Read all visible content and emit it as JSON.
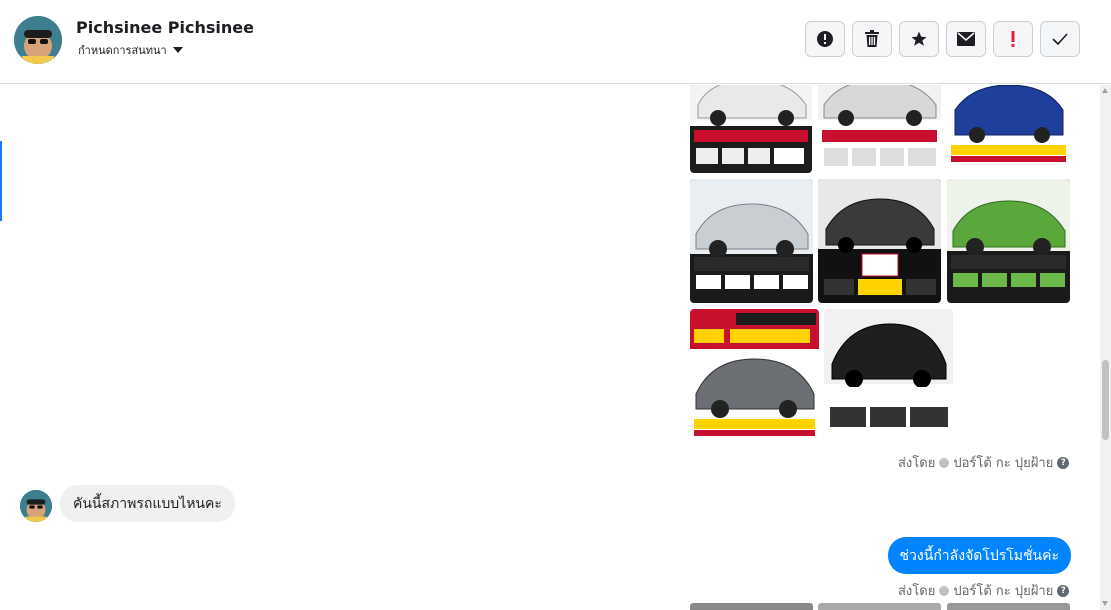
{
  "header": {
    "contact_name": "Pichsinee Pichsinee",
    "subtitle": "กำหนดการสนทนา"
  },
  "toolbar": {
    "buttons": [
      {
        "icon": "alert-circle-icon"
      },
      {
        "icon": "trash-icon"
      },
      {
        "icon": "star-icon"
      },
      {
        "icon": "envelope-icon"
      },
      {
        "icon": "exclamation-icon"
      },
      {
        "icon": "check-icon"
      }
    ]
  },
  "messages": {
    "image_message_meta": {
      "sent_by": "ส่งโดย",
      "sender": "ปอร์โต้ กะ ปุยฝ้าย",
      "help": "?"
    },
    "incoming_text": "คันนี้สภาพรถแบบไหนคะ",
    "outgoing_text": "ช่วงนี้กำลังจัดโปรโมชั่นค่ะ",
    "outgoing_meta": {
      "sent_by": "ส่งโดย",
      "sender": "ปอร์โต้ กะ ปุยฝ้าย",
      "help": "?"
    }
  },
  "colors": {
    "accent": "#0084ff",
    "border": "#dadde1",
    "ad_red": "#c8102e",
    "ad_yellow": "#ffd200"
  }
}
